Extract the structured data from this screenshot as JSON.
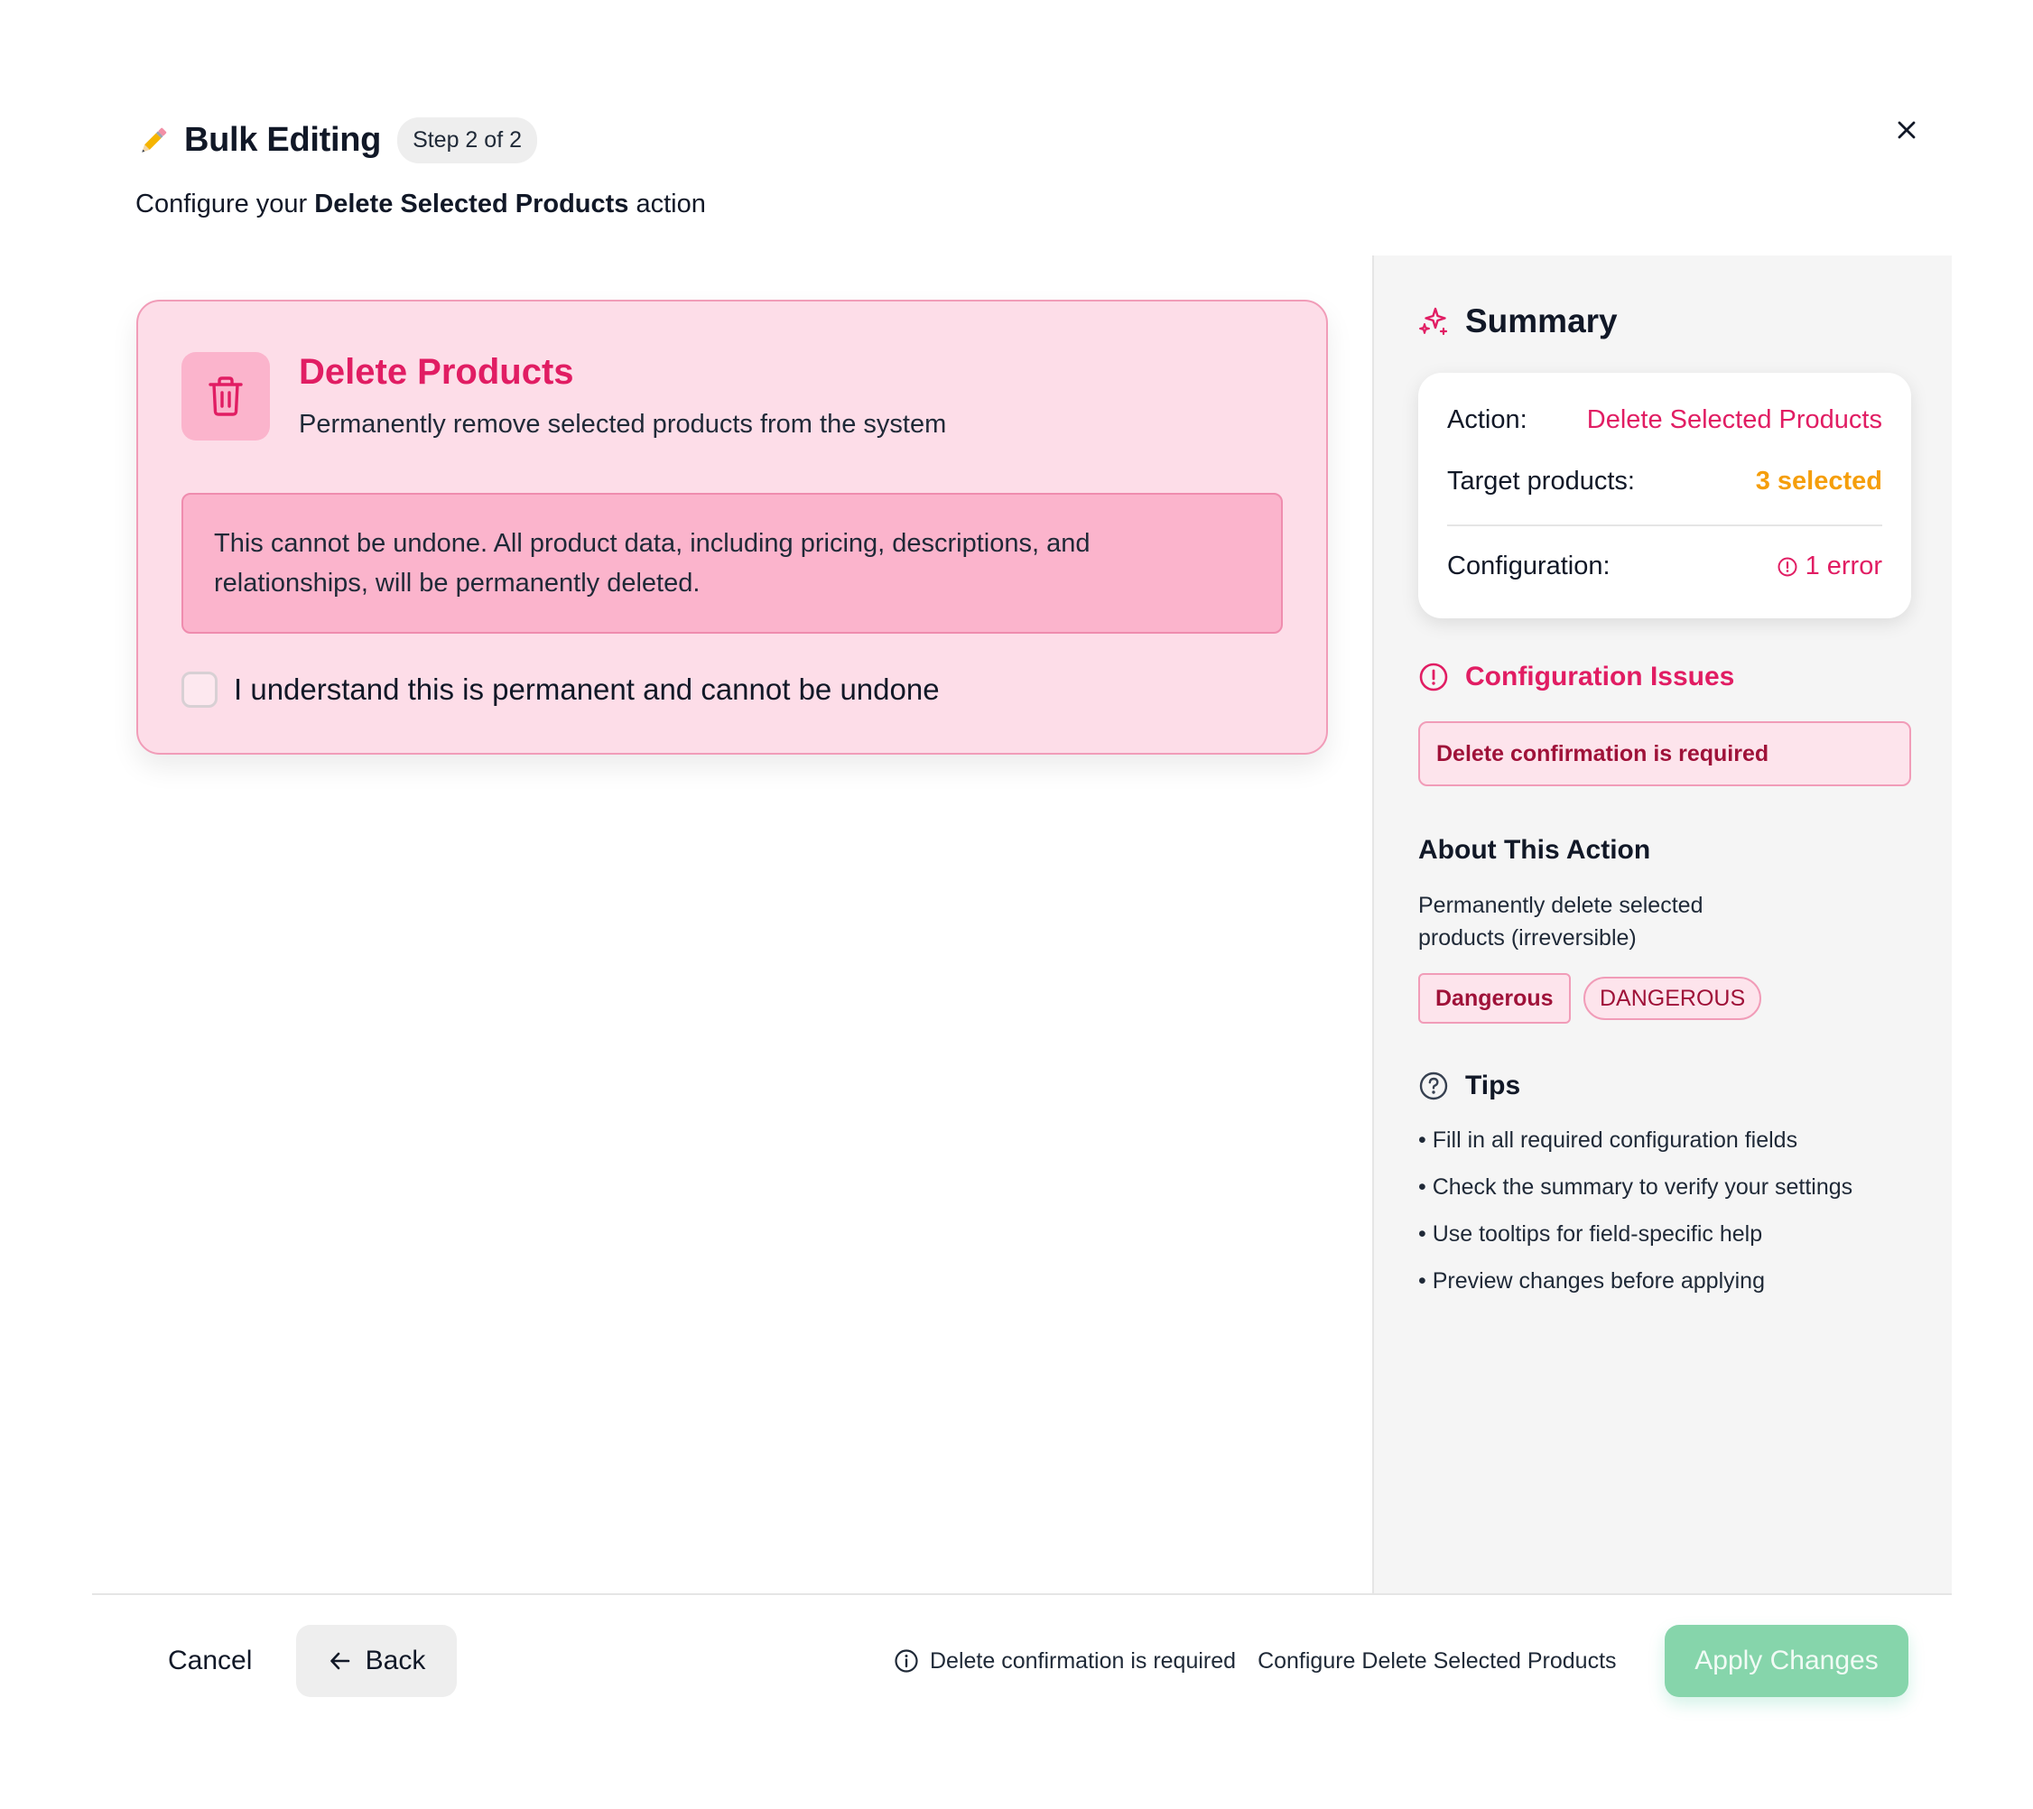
{
  "header": {
    "title": "Bulk Editing",
    "step": "Step 2 of 2",
    "subtitle_prefix": "Configure your ",
    "subtitle_action": "Delete Selected Products",
    "subtitle_suffix": " action"
  },
  "action_card": {
    "title": "Delete Products",
    "description": "Permanently remove selected products from the system",
    "warning": "This cannot be undone. All product data, including pricing, descriptions, and relationships, will be permanently deleted.",
    "confirm_label": "I understand this is permanent and cannot be undone",
    "confirm_checked": false
  },
  "summary": {
    "title": "Summary",
    "action_label": "Action:",
    "action_value": "Delete Selected Products",
    "target_label": "Target products:",
    "target_value": "3 selected",
    "config_label": "Configuration:",
    "config_value": "1 error"
  },
  "issues": {
    "title": "Configuration Issues",
    "items": [
      "Delete confirmation is required"
    ]
  },
  "about": {
    "title": "About This Action",
    "description": "Permanently delete selected products (irreversible)",
    "tag_primary": "Dangerous",
    "tag_secondary": "DANGEROUS"
  },
  "tips": {
    "title": "Tips",
    "items": [
      "• Fill in all required configuration fields",
      "• Check the summary to verify your settings",
      "• Use tooltips for field-specific help",
      "• Preview changes before applying"
    ]
  },
  "footer": {
    "cancel": "Cancel",
    "back": "Back",
    "status_message": "Delete confirmation is required",
    "configure_text": "Configure Delete Selected Products",
    "apply": "Apply Changes"
  },
  "colors": {
    "accent": "#e11d63",
    "warning_bg": "#fbb4cc",
    "card_bg": "#fddde8",
    "amber": "#f59e0b",
    "apply_bg": "#86d5ab"
  },
  "icons": [
    "pencil-icon",
    "close-icon",
    "trash-icon",
    "sparkles-icon",
    "alert-circle-icon",
    "help-circle-icon",
    "arrow-left-icon",
    "info-icon"
  ]
}
